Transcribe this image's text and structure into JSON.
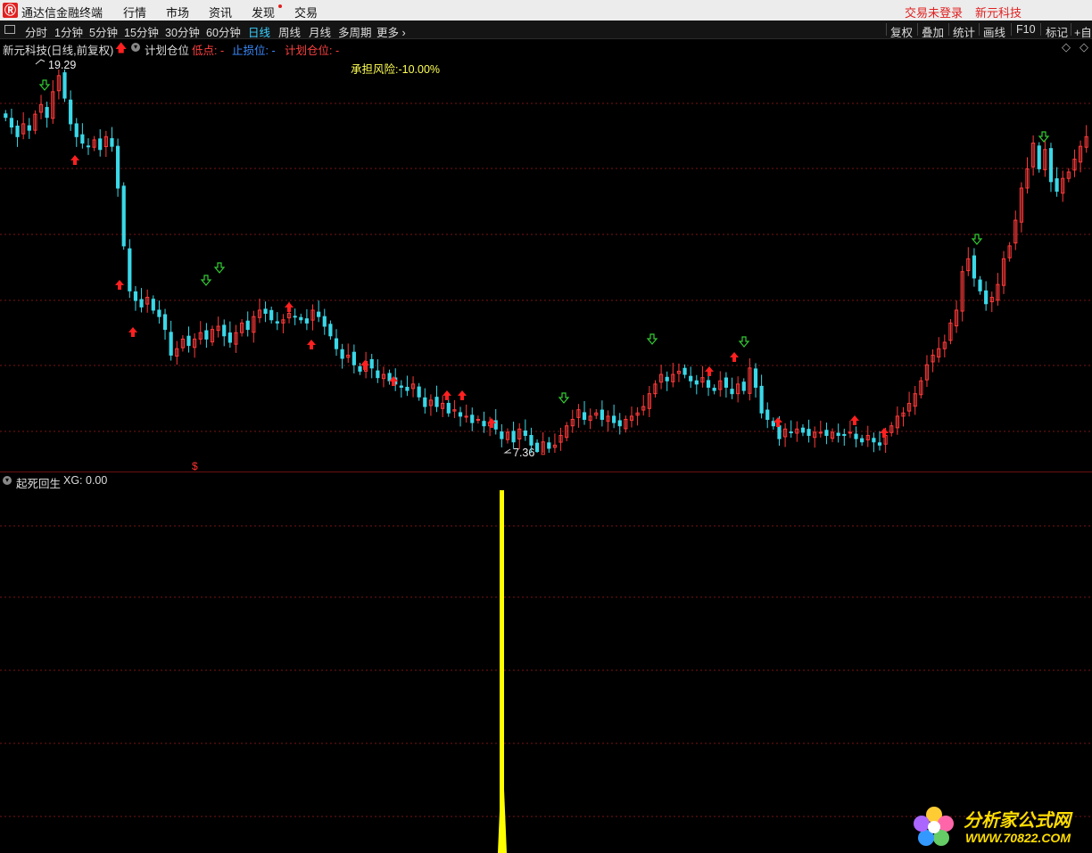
{
  "titlebar": {
    "app_name": "通达信金融终端",
    "menu": [
      "行情",
      "市场",
      "资讯",
      "发现",
      "交易"
    ],
    "login_status": "交易未登录",
    "stock_name": "新元科技"
  },
  "toolbar": {
    "periods": [
      "分时",
      "1分钟",
      "5分钟",
      "15分钟",
      "30分钟",
      "60分钟",
      "日线",
      "周线",
      "月线",
      "多周期",
      "更多 ›"
    ],
    "active_period": "日线",
    "right_buttons": [
      "复权",
      "叠加",
      "统计",
      "画线",
      "F10",
      "标记",
      "+自"
    ]
  },
  "chart_header": {
    "title": "新元科技(日线,前复权)",
    "plan_label": "计划仓位",
    "low_label": "低点: -",
    "stop_label": "止损位: -",
    "plan_pos_label": "计划仓位: -",
    "risk_label": "承担风险:-10.00%"
  },
  "price": {
    "high_label": "19.29",
    "low_label": "7.36",
    "high": 19.29,
    "low": 7.36
  },
  "dollar_marker": "$",
  "indicator": {
    "name": "起死回生",
    "value_label": "XG: 0.00"
  },
  "watermark": {
    "brand": "分析家公式网",
    "url": "WWW.70822.COM"
  },
  "colors": {
    "background": "#000000",
    "up": "#ff3a3a",
    "down": "#3ad8e8",
    "grid": "#7a1414",
    "signal_bar": "#ffff00",
    "buy_arrow": "#ff2020",
    "sell_arrow": "#33cc33",
    "risk_text": "#ffff55"
  },
  "chart_data": {
    "type": "candlestick",
    "title": "新元科技(日线,前复权)",
    "period": "日线",
    "high": 19.29,
    "low": 7.36,
    "close_series": [
      17.8,
      17.5,
      17.2,
      17.6,
      17.4,
      17.9,
      18.2,
      17.8,
      18.6,
      19.1,
      18.4,
      17.6,
      17.2,
      17.0,
      16.9,
      17.1,
      16.8,
      17.2,
      16.9,
      15.6,
      13.8,
      12.4,
      12.1,
      11.9,
      12.2,
      11.8,
      11.6,
      11.2,
      10.4,
      10.6,
      10.9,
      10.7,
      10.9,
      11.1,
      10.9,
      11.2,
      11.3,
      11.0,
      10.8,
      11.1,
      11.4,
      11.2,
      11.6,
      11.8,
      11.7,
      11.5,
      11.4,
      11.5,
      11.7,
      11.6,
      11.5,
      11.4,
      11.8,
      11.6,
      11.3,
      11.0,
      10.6,
      10.3,
      10.4,
      10.1,
      9.9,
      10.2,
      10.0,
      9.7,
      9.8,
      9.6,
      9.5,
      9.4,
      9.3,
      9.5,
      9.1,
      8.8,
      9.0,
      8.8,
      8.9,
      8.6,
      8.7,
      8.5,
      8.5,
      8.3,
      8.4,
      8.2,
      8.3,
      8.1,
      7.8,
      8.0,
      7.7,
      8.1,
      7.9,
      7.6,
      7.4,
      7.7,
      7.5,
      7.6,
      7.9,
      8.2,
      8.4,
      8.7,
      8.4,
      8.5,
      8.6,
      8.4,
      8.5,
      8.3,
      8.2,
      8.4,
      8.5,
      8.6,
      8.8,
      9.2,
      9.5,
      9.8,
      9.6,
      9.8,
      9.9,
      9.8,
      9.6,
      9.5,
      9.7,
      9.4,
      9.3,
      9.6,
      9.4,
      9.2,
      9.5,
      9.3,
      10.0,
      9.4,
      8.6,
      8.4,
      8.2,
      7.8,
      8.1,
      8.0,
      8.1,
      8.0,
      7.9,
      8.0,
      8.0,
      7.9,
      8.0,
      7.9,
      7.9,
      8.0,
      7.8,
      7.7,
      7.9,
      7.7,
      7.6,
      7.9,
      8.2,
      8.5,
      8.6,
      8.9,
      9.2,
      9.6,
      10.1,
      10.4,
      10.6,
      10.8,
      11.4,
      11.8,
      13.0,
      13.4,
      12.8,
      12.4,
      12.0,
      12.2,
      12.6,
      13.4,
      13.8,
      14.6,
      15.6,
      16.2,
      17.0,
      16.2,
      16.8,
      15.8,
      15.5,
      15.9,
      16.1,
      16.5,
      16.9,
      17.2
    ]
  }
}
